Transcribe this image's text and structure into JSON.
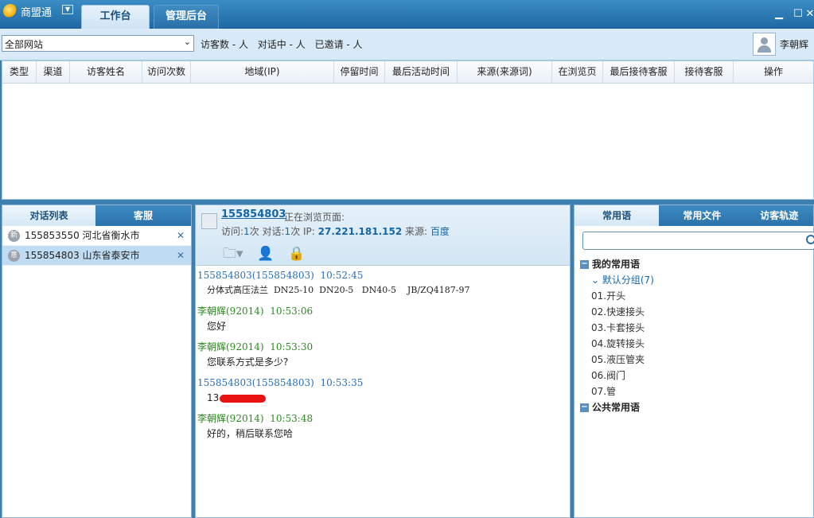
{
  "app": {
    "name": "商盟通",
    "tabs": [
      {
        "label": "工作台",
        "active": true
      },
      {
        "label": "管理后台",
        "active": false
      }
    ]
  },
  "toolbar": {
    "site_select": "全部网站",
    "stats": [
      "访客数 - 人",
      "对话中 - 人",
      "已邀请 - 人"
    ],
    "user": "李朝辉"
  },
  "visitor_table": {
    "columns": [
      "类型",
      "渠道",
      "访客姓名",
      "访问次数",
      "地域(IP)",
      "停留时间",
      "最后活动时间",
      "来源(来源词)",
      "在浏览页",
      "最后接待客服",
      "接待客服",
      "操作"
    ]
  },
  "left_panel": {
    "tabs": [
      "对话列表",
      "客服"
    ],
    "conversations": [
      {
        "badge": "新",
        "id": "155853550",
        "region": "河北省衡水市",
        "selected": false
      },
      {
        "badge": "意",
        "id": "155854803",
        "region": "山东省泰安市",
        "selected": true
      }
    ]
  },
  "chat": {
    "visitor_id": "155854803",
    "status": "正在浏览页面:",
    "visits_label": "访问:",
    "visits": "1",
    "sessions_label": "次 对话:",
    "sessions": "1",
    "ip_label": "次 IP:",
    "ip": "27.221.181.152",
    "source_label": "来源:",
    "source": "百度",
    "messages": [
      {
        "role": "visitor",
        "sender": "155854803(155854803)",
        "time": "10:52:45",
        "text": "分体式高压法兰  DN25-10  DN20-5   DN40-5    JB/ZQ4187-97"
      },
      {
        "role": "agent",
        "sender": "李朝辉(92014)",
        "time": "10:53:06",
        "text": "您好"
      },
      {
        "role": "agent",
        "sender": "李朝辉(92014)",
        "time": "10:53:30",
        "text": "您联系方式是多少?"
      },
      {
        "role": "visitor",
        "sender": "155854803(155854803)",
        "time": "10:53:35",
        "text": "13"
      },
      {
        "role": "agent",
        "sender": "李朝辉(92014)",
        "time": "10:53:48",
        "text": "好的，稍后联系您哈"
      }
    ]
  },
  "right_panel": {
    "tabs": [
      "常用语",
      "常用文件",
      "访客轨迹"
    ],
    "search_placeholder": "",
    "my_phrases": "我的常用语",
    "default_group": "默认分组(7)",
    "phrases": [
      "01.开头",
      "02.快速接头",
      "03.卡套接头",
      "04.旋转接头",
      "05.液压管夹",
      "06.阀门",
      "07.管"
    ],
    "public_phrases": "公共常用语"
  }
}
